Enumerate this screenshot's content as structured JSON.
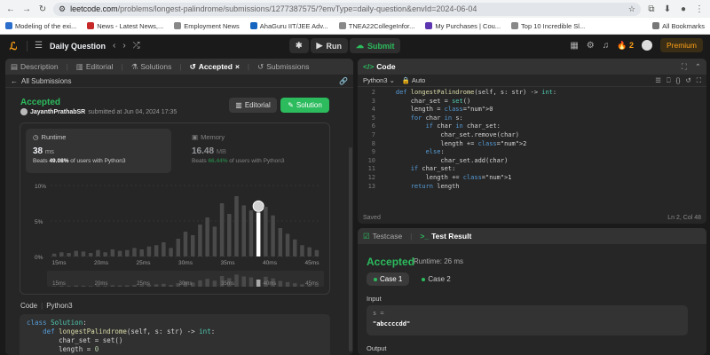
{
  "browser": {
    "url_host": "leetcode.com",
    "url_path": "/problems/longest-palindrome/submissions/1277387575/?envType=daily-question&envId=2024-06-04",
    "bookmarks": [
      {
        "label": "Modeling of the exi..."
      },
      {
        "label": "News - Latest News,..."
      },
      {
        "label": "Employment News"
      },
      {
        "label": "AhaGuru IIT/JEE Adv..."
      },
      {
        "label": "TNEA22CollegeInfor..."
      },
      {
        "label": "My Purchases | Cou..."
      },
      {
        "label": "Top 10 Incredible Sl..."
      }
    ],
    "all_bookmarks": "All Bookmarks"
  },
  "header": {
    "title": "Daily Question",
    "run_label": "Run",
    "submit_label": "Submit",
    "streak": "2",
    "premium_label": "Premium"
  },
  "left": {
    "tabs": [
      {
        "label": "Description"
      },
      {
        "label": "Editorial"
      },
      {
        "label": "Solutions"
      },
      {
        "label": "Accepted"
      },
      {
        "label": "Submissions"
      }
    ],
    "back_label": "All Submissions",
    "status": "Accepted",
    "user": "JayanthPrathabSR",
    "submitted_text": "submitted at Jun 04, 2024 17:35",
    "editorial_btn": "Editorial",
    "solution_btn": "Solution",
    "runtime": {
      "label": "Runtime",
      "value": "38",
      "unit": "ms",
      "beats_prefix": "Beats",
      "beats_value": "49.08%",
      "beats_suffix": "of users with Python3"
    },
    "memory": {
      "label": "Memory",
      "value": "16.48",
      "unit": "MB",
      "beats_prefix": "Beats",
      "beats_value": "66.44%",
      "beats_suffix": "of users with Python3"
    },
    "code_label": "Code",
    "code_lang": "Python3",
    "snippet": [
      "class Solution:",
      "    def longestPalindrome(self, s: str) -> int:",
      "        char_set = set()",
      "        length = 0"
    ]
  },
  "chart_data": {
    "type": "bar",
    "title": "",
    "ylabel": "",
    "xlabel": "",
    "y_ticks": [
      "10%",
      "5%",
      "0%"
    ],
    "ylim": [
      0,
      10
    ],
    "x_ticks": [
      "15ms",
      "20ms",
      "25ms",
      "30ms",
      "35ms",
      "40ms",
      "45ms"
    ],
    "x_range_ms": [
      14,
      46
    ],
    "values": [
      0.4,
      0.6,
      0.5,
      0.8,
      0.7,
      0.5,
      0.9,
      0.6,
      1.0,
      0.8,
      0.9,
      1.2,
      1.0,
      1.4,
      1.6,
      2.0,
      1.2,
      2.5,
      3.5,
      3.0,
      4.5,
      5.5,
      4.2,
      7.5,
      6.0,
      8.5,
      7.2,
      6.5,
      5.0,
      7.0,
      5.8,
      4.0,
      3.2,
      2.4,
      1.6,
      1.3,
      0.9
    ],
    "highlight_index": 28,
    "highlight_label": "38ms"
  },
  "editor": {
    "title": "Code",
    "language": "Python3",
    "mode": "Auto",
    "lines": [
      {
        "n": "2",
        "code": "    def longestPalindrome(self, s: str) -> int:"
      },
      {
        "n": "3",
        "code": "        char_set = set()"
      },
      {
        "n": "4",
        "code": "        length = 0"
      },
      {
        "n": "5",
        "code": "        for char in s:"
      },
      {
        "n": "6",
        "code": "            if char in char_set:"
      },
      {
        "n": "7",
        "code": "                char_set.remove(char)"
      },
      {
        "n": "8",
        "code": "                length += 2"
      },
      {
        "n": "9",
        "code": "            else:"
      },
      {
        "n": "10",
        "code": "                char_set.add(char)"
      },
      {
        "n": "11",
        "code": "        if char_set:"
      },
      {
        "n": "12",
        "code": "            length += 1"
      },
      {
        "n": "13",
        "code": "        return length"
      }
    ],
    "status": "Saved",
    "cursor": "Ln 2, Col 48"
  },
  "result": {
    "testcase_tab": "Testcase",
    "result_tab": "Test Result",
    "status": "Accepted",
    "runtime": "Runtime: 26 ms",
    "cases": [
      {
        "label": "Case 1"
      },
      {
        "label": "Case 2"
      }
    ],
    "input_label": "Input",
    "input_var": "s =",
    "input_value": "\"abccccdd\"",
    "output_label": "Output"
  },
  "colors": {
    "accent_green": "#2cbb5d",
    "accent_orange": "#ffa116",
    "bg": "#1a1a1a",
    "panel": "#262626"
  }
}
